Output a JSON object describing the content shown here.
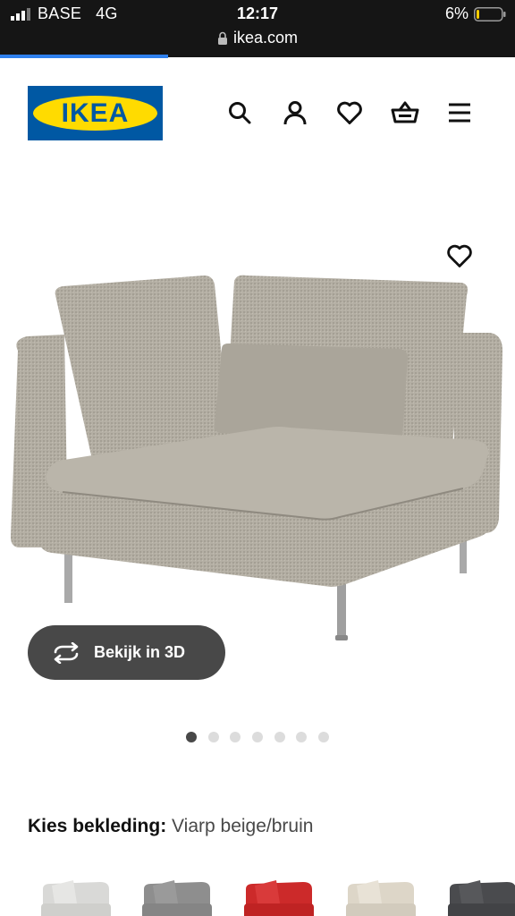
{
  "status_bar": {
    "carrier": "BASE   4G",
    "time": "12:17",
    "battery": "6%",
    "url": "ikea.com"
  },
  "header": {
    "logo_text": "IKEA",
    "icons": [
      "search-icon",
      "account-icon",
      "heart-icon",
      "basket-icon",
      "menu-icon"
    ]
  },
  "product": {
    "view_3d_label": "Bekijk in 3D",
    "gallery": {
      "count": 7,
      "active": 1
    },
    "cover_label": "Kies bekleding:",
    "cover_value": "Viarp beige/bruin",
    "swatches": [
      {
        "name": "light-grey",
        "color": "#d9d9d7"
      },
      {
        "name": "grey",
        "color": "#8e8e8e"
      },
      {
        "name": "red",
        "color": "#cc2a2a"
      },
      {
        "name": "beige",
        "color": "#ddd6c8"
      },
      {
        "name": "dark-grey",
        "color": "#4a4b4e"
      }
    ]
  },
  "colors": {
    "brand_blue": "#0058a3",
    "brand_yellow": "#ffdb00",
    "fabric": "#b3aea3",
    "button_dark": "#484848",
    "progress_blue": "#2f80ed"
  }
}
